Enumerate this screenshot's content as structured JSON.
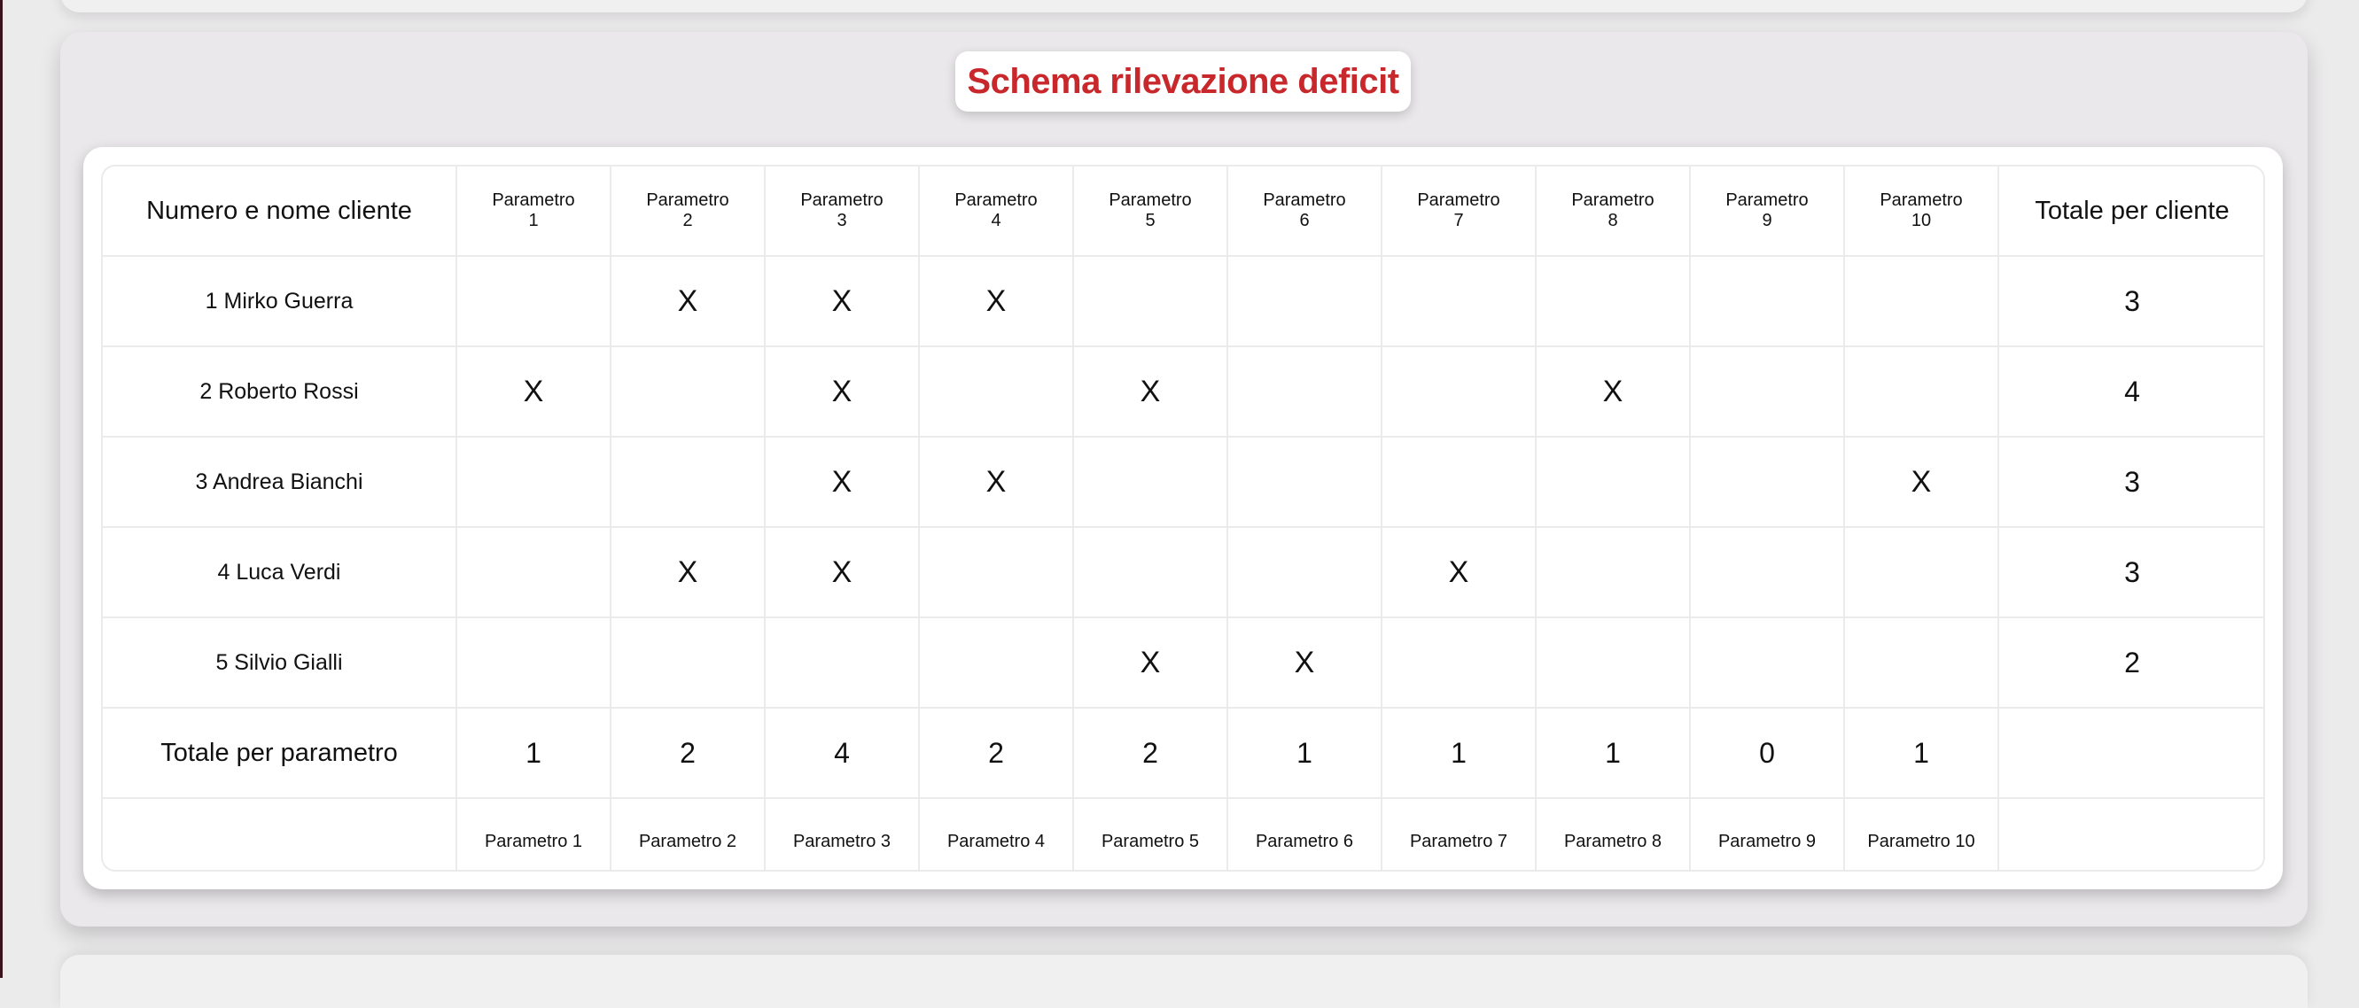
{
  "title": "Schema rilevazione deficit",
  "table": {
    "header": {
      "client_column": "Numero e nome cliente",
      "params": [
        [
          "Parametro",
          "1"
        ],
        [
          "Parametro",
          "2"
        ],
        [
          "Parametro",
          "3"
        ],
        [
          "Parametro",
          "4"
        ],
        [
          "Parametro",
          "5"
        ],
        [
          "Parametro",
          "6"
        ],
        [
          "Parametro",
          "7"
        ],
        [
          "Parametro",
          "8"
        ],
        [
          "Parametro",
          "9"
        ],
        [
          "Parametro",
          "10"
        ]
      ],
      "total_column": "Totale per cliente"
    },
    "mark_symbol": "X",
    "clients": [
      {
        "name": "1 Mirko Guerra",
        "marks": [
          false,
          true,
          true,
          true,
          false,
          false,
          false,
          false,
          false,
          false
        ],
        "total": "3"
      },
      {
        "name": "2 Roberto Rossi",
        "marks": [
          true,
          false,
          true,
          false,
          true,
          false,
          false,
          true,
          false,
          false
        ],
        "total": "4"
      },
      {
        "name": "3 Andrea Bianchi",
        "marks": [
          false,
          false,
          true,
          true,
          false,
          false,
          false,
          false,
          false,
          true
        ],
        "total": "3"
      },
      {
        "name": "4 Luca Verdi",
        "marks": [
          false,
          true,
          true,
          false,
          false,
          false,
          true,
          false,
          false,
          false
        ],
        "total": "3"
      },
      {
        "name": "5 Silvio Gialli",
        "marks": [
          false,
          false,
          false,
          false,
          true,
          true,
          false,
          false,
          false,
          false
        ],
        "total": "2"
      }
    ],
    "totals_row": {
      "label": "Totale per parametro",
      "values": [
        "1",
        "2",
        "4",
        "2",
        "2",
        "1",
        "1",
        "1",
        "0",
        "1"
      ]
    },
    "footer_params": [
      "Parametro 1",
      "Parametro 2",
      "Parametro 3",
      "Parametro 4",
      "Parametro 5",
      "Parametro 6",
      "Parametro 7",
      "Parametro 8",
      "Parametro 9",
      "Parametro 10"
    ]
  },
  "colors": {
    "title": "#c8272b",
    "background": "#ecebec",
    "panel": "#eae8ea",
    "card": "#ffffff",
    "grid_line": "#ebebeb",
    "text": "#111111"
  }
}
